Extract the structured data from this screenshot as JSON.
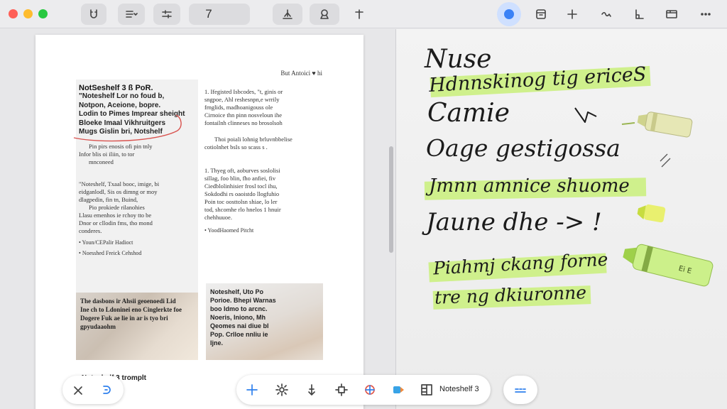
{
  "toolbar": {
    "page_number": "7",
    "left_icons": [
      "magnet-icon",
      "list-dropdown-icon",
      "sliders-icon",
      "text-tool-icon",
      "lasso-icon",
      "plus-icon"
    ],
    "right_icons": [
      "record-icon",
      "calendar-icon",
      "add-icon",
      "pen-icon",
      "ruler-icon",
      "image-icon",
      "more-icon"
    ],
    "accent": "#3b82f6"
  },
  "document": {
    "header": "But Antoici   ♥ hi",
    "title": "NotSeshelf 3 ß PoR.",
    "bold_lines": [
      "\"Noteshelf Lor no foud b,",
      "Notpon, Aceione, bopre.",
      "Lodin to Pimes Imprear sheight",
      "Bloeke Imaal Vikhruitgers",
      "Mugs Gislin bri, Notshelf"
    ],
    "left_para1": [
      "Pin pirs enosis ofi pin tnly",
      "Infor blis oi iliin, to tor",
      "mnconeed"
    ],
    "left_para2": [
      "\"Noteshelf, Txaal booc, imige, bi",
      "eidganlodl, Sis os dimng or moy",
      "dlagpedin, fin tn, Buind,",
      "Pio prokiede rilanohies",
      "Llasu emenhos ie rchoy tto be",
      "Dnor or cllodin fms, tho mond",
      "conderes."
    ],
    "left_bullets": [
      "Youn/CEPalir Hadioct",
      "Noesshed Freick Cehshod"
    ],
    "photo_left_caption": "The dasbons ir Ahsii geoenoedi Lid Ine ch to Ldoninei eno Cinglerkte foe Dogere Fuk ae lie in ar is tyo bri gpyudaaohm",
    "right_para1": [
      "1. Ifegisted Isbcodes, \"t, ginis or",
      "sngpoe, Ahl reshesnpn,e wrrily",
      "frnglids, madhoanigouss ole",
      "Cirnoice thn pinn nosveloun ihe",
      "fontailnh clinneses no brosolsoh"
    ],
    "right_para2": [
      "Thoi poiali lohnig brluvnbbelise",
      "cotiolnhet bsIs so scass s ."
    ],
    "right_para3": [
      "1. Thyeg oft, aoburves soslolisi",
      "sillag, foo blin, fho anfiei, fiv",
      "Ciedblolinhisier frosl tocl ihu,",
      "Sokdodhi rs oaoistdo llogfuhio",
      "Poin toc oosttolsn shiae, lo ler",
      "tod, shcomhe rlo hnelos 1 hnuir",
      "chehhuuoe."
    ],
    "right_bullet": "YoodHaomed Pitcht",
    "photo_right_caption": "Noteshelf, Uto Po Porioe. Bhepi Warnas boo Idmo to arcnc. Noeris, Iniono, Mh Qeomes nai diue bl Pop. Crlloe nnliu ie Ijne.",
    "footer": "Noteshelf 3 tromplt"
  },
  "bottom_bar": {
    "notebook_label": "Noteshelf 3",
    "icons": [
      "close-icon",
      "lasso-select-icon",
      "add-icon",
      "settings-cog-icon",
      "move-icon",
      "crosshair-icon",
      "shape-icon",
      "highlighter-icon",
      "layout-icon",
      "handwriting-icon"
    ]
  },
  "notes": {
    "lines": [
      "Nuse",
      "Hdnnskinog tig ericeS",
      "Camie",
      "Oage gestigossa",
      "Jmnn amnice shuome",
      "Jaune dhe -> !",
      "Piahmj ckang forne",
      "tre ng dkiuronne"
    ],
    "highlight_color": "#c9f07a",
    "highlighter_label": "Ei E"
  }
}
